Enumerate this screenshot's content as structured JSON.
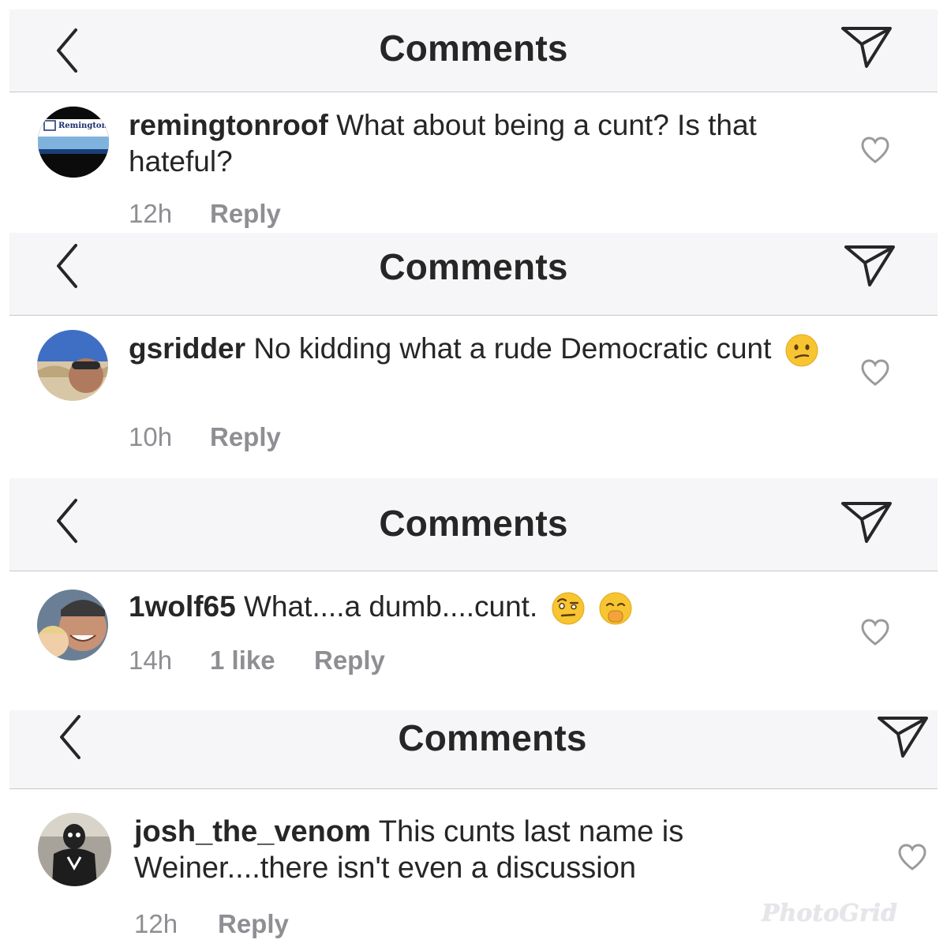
{
  "panels": [
    {
      "header_title": "Comments",
      "username": "remingtonroof",
      "text": "What about being a cunt? Is that hateful?",
      "time": "12h",
      "likes": "",
      "reply": "Reply",
      "avatar_text": "Remington"
    },
    {
      "header_title": "Comments",
      "username": "gsridder",
      "text": "No kidding what a rude Democratic cunt",
      "time": "10h",
      "likes": "",
      "reply": "Reply",
      "emojis": [
        "confused-face"
      ]
    },
    {
      "header_title": "Comments",
      "username": "1wolf65",
      "text": "What....a dumb....cunt.",
      "time": "14h",
      "likes": "1 like",
      "reply": "Reply",
      "emojis": [
        "raised-eyebrow-face",
        "hand-over-mouth-face"
      ]
    },
    {
      "header_title": "Comments",
      "username": "josh_the_venom",
      "text": "This cunts last name is Weiner....there isn't even a discussion",
      "time": "12h",
      "likes": "",
      "reply": "Reply"
    }
  ],
  "watermark": "PhotoGrid",
  "icons": {
    "back": "chevron-left-icon",
    "send": "paper-plane-icon",
    "like": "heart-outline-icon"
  },
  "colors": {
    "header_bg": "#f6f6f8",
    "text": "#262626",
    "meta": "#8e8e93"
  }
}
